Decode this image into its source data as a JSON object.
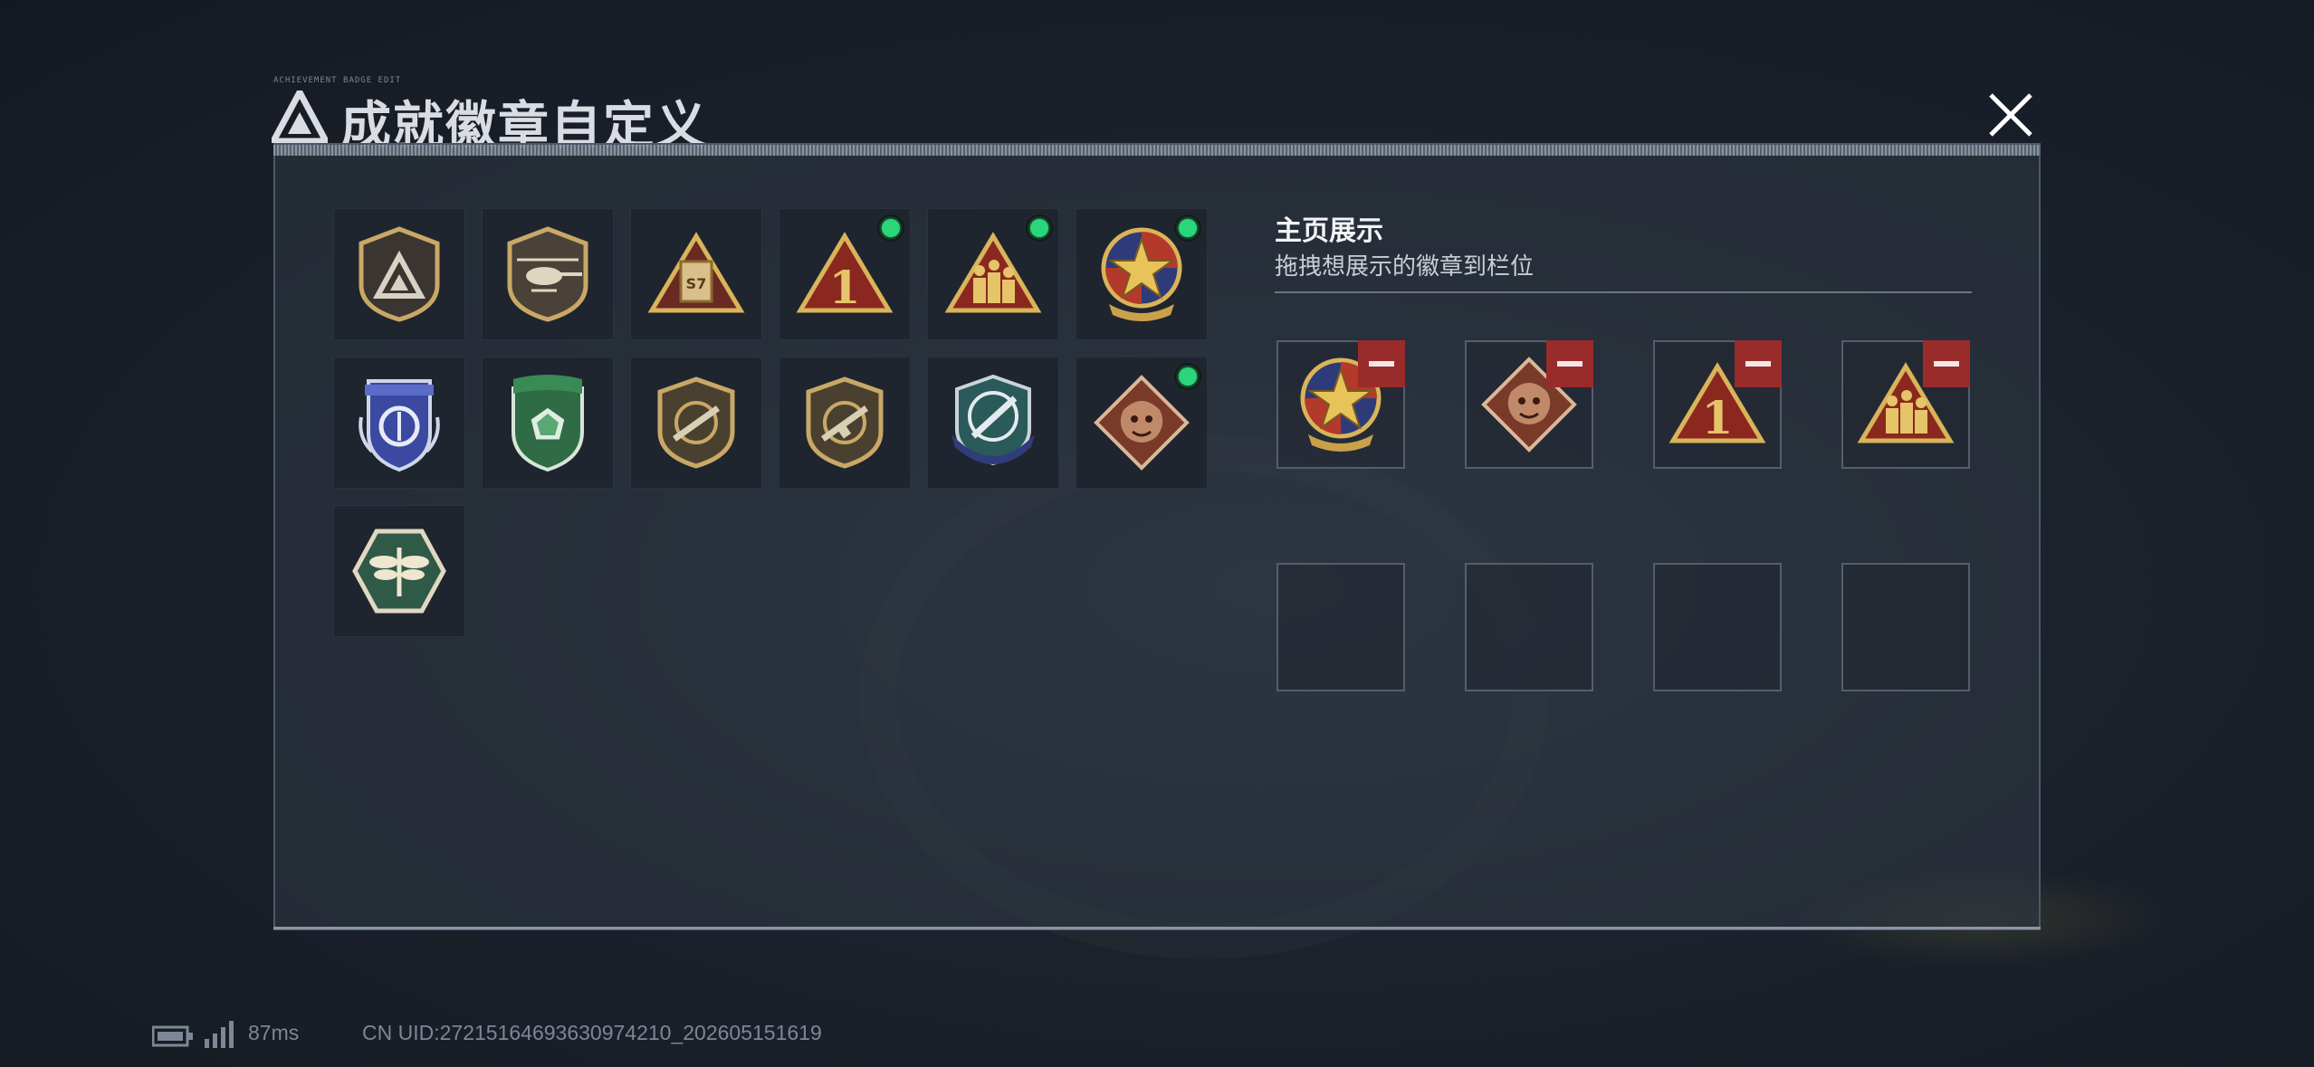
{
  "window": {
    "title": "成就徽章自定义",
    "title_small_text": "ACHIEVEMENT BADGE EDIT"
  },
  "inventory": {
    "badges": [
      {
        "icon": "triangle-logo-shield-icon",
        "equipped": false
      },
      {
        "icon": "helicopter-shield-icon",
        "equipped": false
      },
      {
        "icon": "s7-card-triangle-icon",
        "equipped": false
      },
      {
        "icon": "number-one-triangle-icon",
        "equipped": true
      },
      {
        "icon": "soldiers-triangle-icon",
        "equipped": true
      },
      {
        "icon": "star-round-emblem-icon",
        "equipped": true
      },
      {
        "icon": "blue-winged-shield-icon",
        "equipped": false
      },
      {
        "icon": "green-gem-shield-icon",
        "equipped": false
      },
      {
        "icon": "rifle-shield-icon",
        "equipped": false
      },
      {
        "icon": "rifle-shield-alt-icon",
        "equipped": false
      },
      {
        "icon": "crosshair-rocket-shield-icon",
        "equipped": false
      },
      {
        "icon": "dragon-diamond-icon",
        "equipped": true
      },
      {
        "icon": "dragonfly-hexagon-icon",
        "equipped": false
      }
    ]
  },
  "showcase": {
    "title": "主页展示",
    "subtitle": "拖拽想展示的徽章到栏位",
    "slots": [
      {
        "icon": "star-round-emblem-icon",
        "filled": true
      },
      {
        "icon": "dragon-diamond-icon",
        "filled": true
      },
      {
        "icon": "number-one-triangle-icon",
        "filled": true
      },
      {
        "icon": "soldiers-triangle-icon",
        "filled": true
      },
      {
        "icon": "",
        "filled": false
      },
      {
        "icon": "",
        "filled": false
      },
      {
        "icon": "",
        "filled": false
      },
      {
        "icon": "",
        "filled": false
      }
    ]
  },
  "status_bar": {
    "ping": "87ms",
    "uid": "CN UID:27215164693630974210_202605151619"
  },
  "colors": {
    "accent_green": "#2bd67b",
    "remove_red": "#9a2b2b",
    "panel_border": "#4d5868"
  }
}
